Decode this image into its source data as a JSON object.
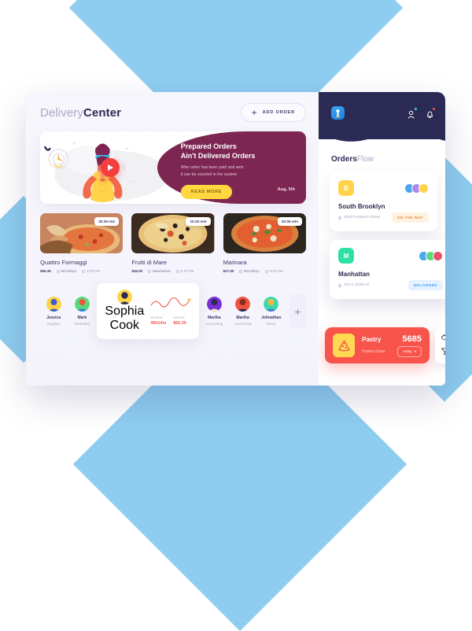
{
  "background": {
    "diamond_color": "#8ecdf0",
    "canvas": "#ffffff"
  },
  "app": {
    "logo_soft": "Delivery",
    "logo_bold": "Center",
    "add_order_label": "ADD ORDER",
    "add_order_icon": "plus-icon"
  },
  "banner": {
    "title_line1": "Prepared Orders",
    "title_line2": "Ain't Delivered Orders",
    "body_line1": "After odrer has been paid and sent",
    "body_line2": "it can be counted in the system",
    "cta": "READ MORE",
    "date": "Aug, 5th",
    "play_icon": "play-icon",
    "accent": "#7c2651",
    "cta_color": "#ffd740"
  },
  "dishes": [
    {
      "name": "Quattro Formaggi",
      "time_badge": "30:35 min",
      "price": "$55.35",
      "place": "Brooklyn",
      "eta": "4:00 PM",
      "img_from": "#d9987a",
      "img_to": "#b35f3c"
    },
    {
      "name": "Frutti di Mare",
      "time_badge": "10:20 min",
      "price": "$45.00",
      "place": "Manhattan",
      "eta": "5:10 PM",
      "img_from": "#e3b277",
      "img_to": "#c2763c"
    },
    {
      "name": "Marinara",
      "time_badge": "30:35 min",
      "price": "$27.50",
      "place": "Brooklyn",
      "eta": "6:15 PM",
      "img_from": "#d9713f",
      "img_to": "#a8401f"
    }
  ],
  "staff": [
    {
      "name": "Jessica",
      "role": "Supplies",
      "color_a": "#ffd24a",
      "color_b": "#3f5fc4"
    },
    {
      "name": "Mark",
      "role": "Marketing",
      "color_a": "#58d97b",
      "color_b": "#f0543f"
    },
    {
      "name": "Martha",
      "role": "Accounting",
      "color_a": "#7a2fd6",
      "color_b": "#2b2a54"
    },
    {
      "name": "Martha",
      "role": "Accounting",
      "color_a": "#f0543f",
      "color_b": "#8c2b22"
    },
    {
      "name": "Johnathan",
      "role": "Driver",
      "color_a": "#3fd6b0",
      "color_b": "#f0b93f"
    }
  ],
  "featured_staff": {
    "name": "Sophia",
    "role": "Cook",
    "worked_label": "Worked",
    "worked_value": "45h14m",
    "earned_label": "Earned",
    "earned_value": "$55.35",
    "color_a": "#ffd24a",
    "color_b": "#2b2a54",
    "chart_color": "#f4564a"
  },
  "add_staff_icon": "plus-icon",
  "phone": {
    "logo_icon": "app-logo-icon",
    "profile_icon": "person-badge-icon",
    "bell_icon": "bell-icon",
    "header_bg": "#2b2a54",
    "title_a": "Orders",
    "title_b": "Flow",
    "orders": [
      {
        "initial": "B",
        "initial_bg": "#ffd24a",
        "initial_fg": "#ffffff",
        "name": "South Brooklyn",
        "address": "1945 Frederick Street",
        "status": "ON THE WAY",
        "status_style": "st-way",
        "avatars": [
          "#49a8f0",
          "#b08ae8",
          "#ffd24a"
        ]
      },
      {
        "initial": "M",
        "initial_bg": "#2fe0a6",
        "initial_fg": "#ffffff",
        "name": "Manhattan",
        "address": "232 E 103rd St",
        "status": "DELIVERED",
        "status_style": "st-del",
        "avatars": [
          "#49a8f0",
          "#58d97b",
          "#e8506a"
        ]
      }
    ],
    "pastry": {
      "icon": "pizza-slice-icon",
      "title": "Pastry",
      "count": "5685",
      "subtitle": "Orders Done",
      "filter": "today",
      "filter_caret": "chevron-down-icon",
      "bg": "#f8544c"
    },
    "side_icons": [
      {
        "name": "bowl-icon"
      },
      {
        "name": "cocktail-glass-icon"
      }
    ]
  }
}
